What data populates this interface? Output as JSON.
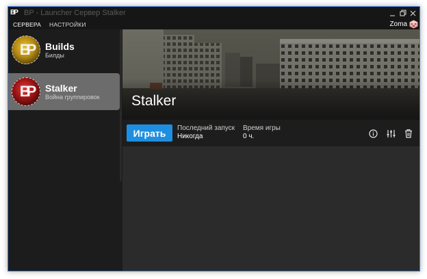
{
  "window": {
    "title": "BP - Launcher Сервер Stalker",
    "logo_text": "BP"
  },
  "menu": {
    "items": [
      {
        "label": "СЕРВЕРА",
        "active": true
      },
      {
        "label": "НАСТРОЙКИ",
        "active": false
      }
    ]
  },
  "user": {
    "name": "Zoma"
  },
  "sidebar": {
    "servers": [
      {
        "name": "Builds",
        "description": "Билды",
        "logo_text": "BP",
        "logo_color": "#d4a81c",
        "selected": false
      },
      {
        "name": "Stalker",
        "description": "Война группировок",
        "logo_text": "BP",
        "logo_color": "#c41f1f",
        "selected": true
      }
    ]
  },
  "main": {
    "server_title": "Stalker",
    "play_label": "Играть",
    "last_launch_label": "Последний запуск",
    "last_launch_value": "Никогда",
    "playtime_label": "Время игры",
    "playtime_value": "0 ч."
  },
  "icons": {
    "info": "info-icon",
    "settings": "sliders-icon",
    "delete": "trash-icon"
  },
  "colors": {
    "accent": "#1e8fe0",
    "window_border": "#3e7fd6",
    "selected_item": "#6c6c6c"
  }
}
